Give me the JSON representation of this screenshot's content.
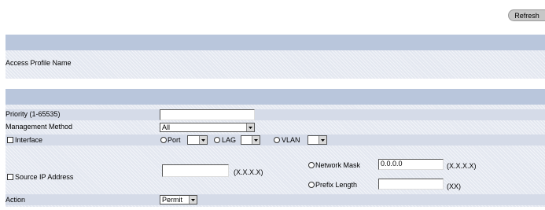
{
  "toolbar": {
    "refresh_label": "Refresh"
  },
  "profile_panel": {
    "name_label": "Access Profile Name"
  },
  "form": {
    "priority": {
      "label": "Priority (1-65535)",
      "value": ""
    },
    "management_method": {
      "label": "Management Method",
      "value": "All"
    },
    "interface": {
      "label": "Interface",
      "port_label": "Port",
      "lag_label": "LAG",
      "vlan_label": "VLAN"
    },
    "source_ip": {
      "label": "Source IP Address",
      "value": "",
      "format_hint": "(X.X.X.X)",
      "network_mask_label": "Network Mask",
      "network_mask_value": "0.0.0.0",
      "network_mask_hint": "(X.X.X.X)",
      "prefix_length_label": "Prefix Length",
      "prefix_length_value": "",
      "prefix_length_hint": "(XX)"
    },
    "action": {
      "label": "Action",
      "value": "Permit"
    }
  }
}
